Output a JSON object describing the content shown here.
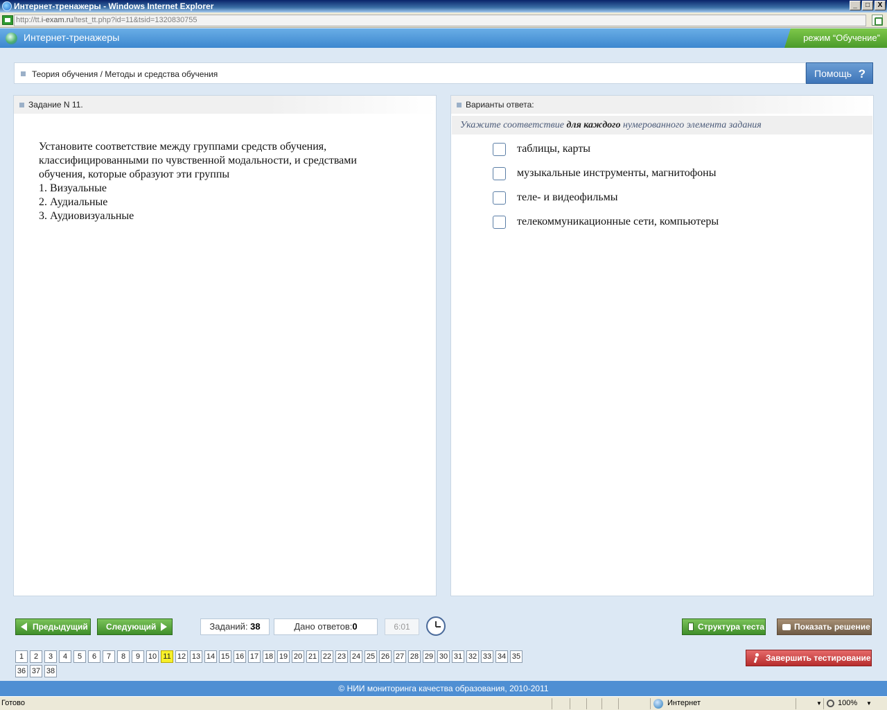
{
  "window": {
    "title": "Интернет-тренажеры - Windows Internet Explorer",
    "address_prefix": "http://tt.",
    "address_domain": "i-exam.ru",
    "address_suffix": "/test_tt.php?id=11&tsid=1320830755",
    "min": "_",
    "max": "□",
    "close": "X"
  },
  "app": {
    "title": "Интернет-тренажеры",
    "mode": "режим “Обучение”"
  },
  "breadcrumb": "Теория обучения / Методы и средства обучения",
  "help_label": "Помощь",
  "help_icon": "?",
  "task": {
    "header": "Задание N 11.",
    "text_lines": [
      "Установите соответствие между группами средств обучения,",
      "классифицированными по чувственной модальности, и средствами",
      "обучения, которые образуют эти группы",
      "1. Визуальные",
      "2. Аудиальные",
      "3. Аудиовизуальные"
    ]
  },
  "answers": {
    "header": "Варианты ответа:",
    "hint_pre": "Укажите соответствие ",
    "hint_bold": "для каждого",
    "hint_post": " нумерованного элемента задания",
    "options": [
      "таблицы, карты",
      "музыкальные инструменты, магнитофоны",
      "теле- и видеофильмы",
      "телекоммуникационные сети, компьютеры"
    ]
  },
  "toolbar": {
    "prev_label": "Предыдущий",
    "next_label": "Следующий",
    "tasks_label": "Заданий: ",
    "tasks_count": "38",
    "answered_label": "Дано ответов:",
    "answered_count": "0",
    "timer": "6:01",
    "structure_label": "Структура теста",
    "show_solution_label": "Показать решение",
    "finish_label": "Завершить тестирование"
  },
  "pages": {
    "current": 11,
    "list": [
      "1",
      "2",
      "3",
      "4",
      "5",
      "6",
      "7",
      "8",
      "9",
      "10",
      "11",
      "12",
      "13",
      "14",
      "15",
      "16",
      "17",
      "18",
      "19",
      "20",
      "21",
      "22",
      "23",
      "24",
      "25",
      "26",
      "27",
      "28",
      "29",
      "30",
      "31",
      "32",
      "33",
      "34",
      "35",
      "36",
      "37",
      "38"
    ]
  },
  "footer": "© НИИ мониторинга качества образования, 2010-2011",
  "status": {
    "ready": "Готово",
    "zone": "Интернет",
    "zoom": "100%"
  },
  "colors": {
    "header_blue": "#3c87cf",
    "mode_green": "#4a9a2a",
    "nav_green": "#3f8e2a",
    "finish_red": "#b72d2d",
    "current_page_yellow": "#f7f02a"
  }
}
